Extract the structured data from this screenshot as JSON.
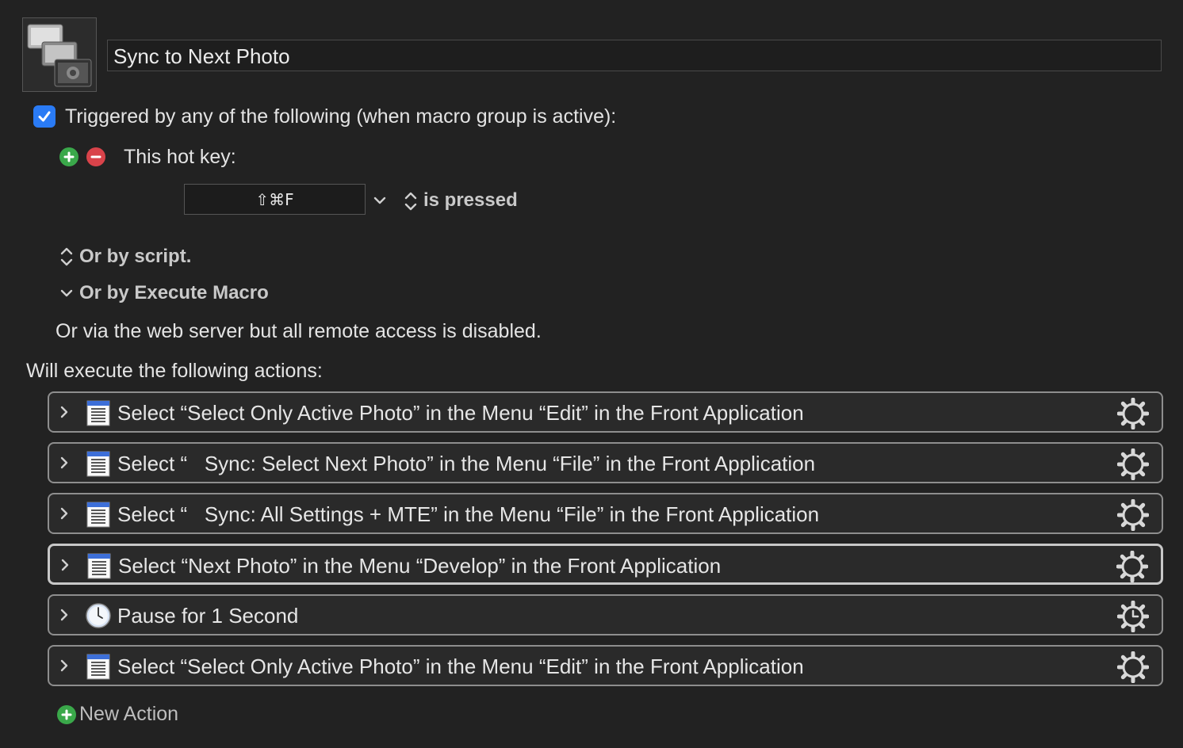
{
  "macro": {
    "title": "Sync to Next Photo",
    "icon": "stacked-photos-icon"
  },
  "triggers": {
    "enabled": true,
    "heading": "Triggered by any of the following (when macro group is active):",
    "hotkey_label": "This hot key:",
    "hotkey_value": "⇧⌘F",
    "hotkey_condition": "is pressed",
    "or_by_script": "Or by script.",
    "or_by_execute_macro": "Or by Execute Macro",
    "web_server_note": "Or via the web server but all remote access is disabled."
  },
  "actions_heading": "Will execute the following actions:",
  "actions": [
    {
      "label": "Select “Select Only Active Photo” in the Menu “Edit” in the Front Application",
      "icon": "menu-list-icon",
      "selected": false
    },
    {
      "label": "Select “   Sync: Select Next Photo” in the Menu “File” in the Front Application",
      "icon": "menu-list-icon",
      "selected": false
    },
    {
      "label": "Select “   Sync: All Settings + MTE” in the Menu “File” in the Front Application",
      "icon": "menu-list-icon",
      "selected": false
    },
    {
      "label": "Select “Next Photo” in the Menu “Develop” in the Front Application",
      "icon": "menu-list-icon",
      "selected": true
    },
    {
      "label": "Pause for 1 Second",
      "icon": "clock-icon",
      "selected": false
    },
    {
      "label": "Select “Select Only Active Photo” in the Menu “Edit” in the Front Application",
      "icon": "menu-list-icon",
      "selected": false
    }
  ],
  "new_action_label": "New Action",
  "colors": {
    "background": "#222222",
    "checkbox": "#2a7bf5",
    "add_green": "#3aa84a",
    "remove_red": "#d9434a"
  }
}
